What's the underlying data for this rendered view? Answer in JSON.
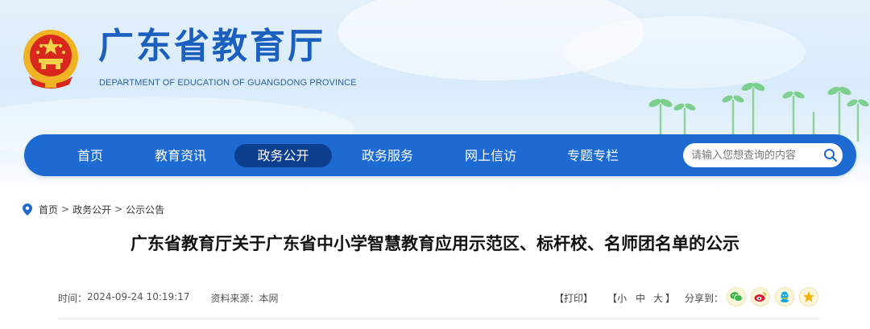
{
  "site": {
    "title": "广东省教育厅",
    "subtitle": "DEPARTMENT OF EDUCATION OF GUANGDONG PROVINCE"
  },
  "nav": {
    "items": [
      {
        "label": "首页"
      },
      {
        "label": "教育资讯"
      },
      {
        "label": "政务公开"
      },
      {
        "label": "政务服务"
      },
      {
        "label": "网上信访"
      },
      {
        "label": "专题专栏"
      }
    ],
    "active": "政务公开"
  },
  "search": {
    "placeholder": "请输入您想查询的内容",
    "value": ""
  },
  "breadcrumb": {
    "items": [
      "首页",
      "政务公开",
      "公示公告"
    ],
    "separator": ">"
  },
  "article": {
    "title": "广东省教育厅关于广东省中小学智慧教育应用示范区、标杆校、名师团名单的公示",
    "time_label": "时间：",
    "time": "2024-09-24 10:19:17",
    "source_label": "资料来源：",
    "source": "本网"
  },
  "tools": {
    "print": "【打印】",
    "font_open": "【",
    "font_small": "小",
    "font_medium": "中",
    "font_large": "大",
    "font_close": "】",
    "share_label": "分享到：",
    "share_icons": [
      "wechat-icon",
      "weibo-icon",
      "qq-icon",
      "qzone-icon"
    ]
  },
  "colors": {
    "nav_bg": "#1c6ad2",
    "nav_active": "#0d3f8f",
    "title_blue": "#1b5fbf",
    "share_bg": "#fbf6dc"
  }
}
